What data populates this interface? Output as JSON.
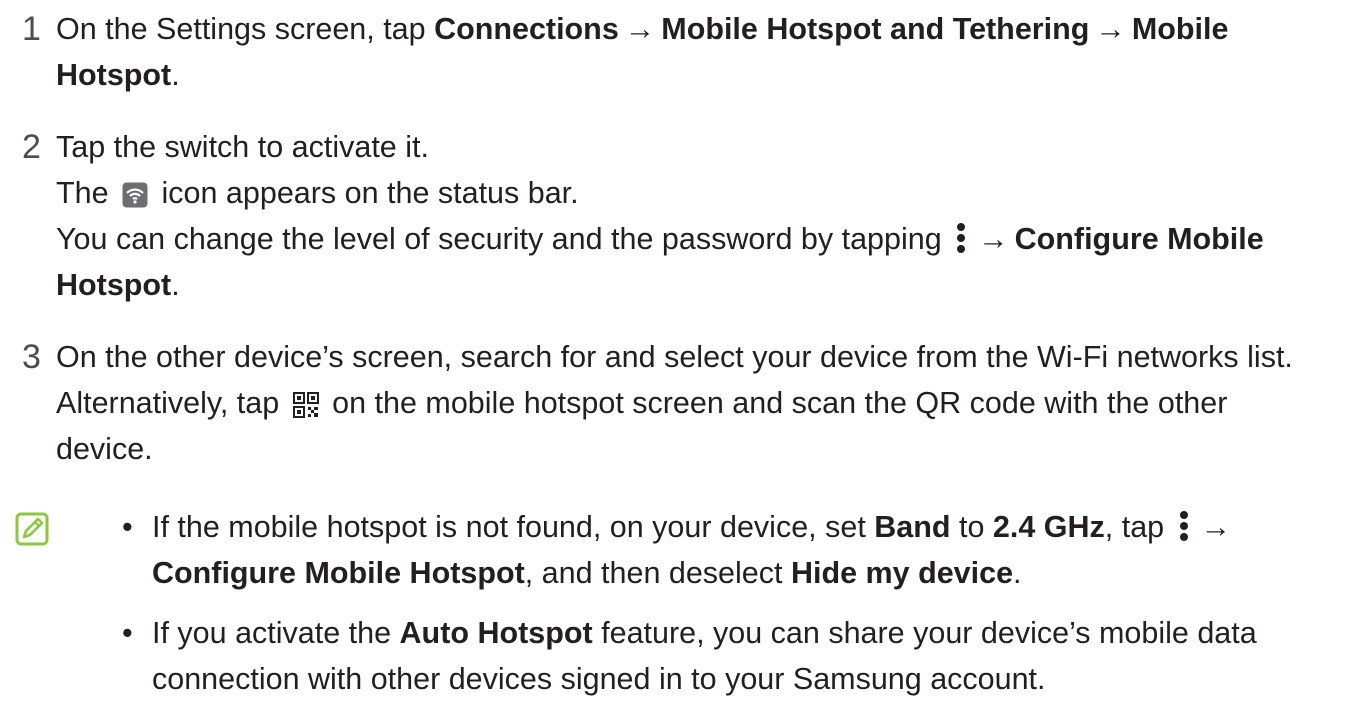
{
  "steps": [
    {
      "number": "1",
      "lines": [
        [
          "On the Settings screen, tap ",
          "Connections",
          "→",
          "Mobile Hotspot and Tethering",
          "→",
          "Mobile"
        ],
        [
          "Hotspot",
          "."
        ]
      ]
    },
    {
      "number": "2",
      "line1": "Tap the switch to activate it.",
      "line2_a": "The ",
      "line2_b": " icon appears on the status bar.",
      "line3_a": "You can change the level of security and the password by tapping ",
      "line3_arrow": "→",
      "line3_bold": "Configure Mobile",
      "line4_bold": "Hotspot",
      "line4_end": "."
    },
    {
      "number": "3",
      "line1": "On the other device’s screen, search for and select your device from the Wi-Fi networks list.",
      "line2_a": "Alternatively, tap ",
      "line2_b": " on the mobile hotspot screen and scan the QR code with the other",
      "line3": "device."
    }
  ],
  "note": {
    "icon": "note-icon",
    "bullet_glyph": "•",
    "b1_l1_a": "If the mobile hotspot is not found, on your device, set ",
    "b1_l1_band": "Band",
    "b1_l1_to": " to ",
    "b1_l1_ghz": "2.4 GHz",
    "b1_l1_tap": ", tap ",
    "b1_l1_arrow": "→",
    "b1_l2_bold": "Configure Mobile Hotspot",
    "b1_l2_mid": ", and then deselect ",
    "b1_l2_bold2": "Hide my device",
    "b1_l2_end": ".",
    "b2_l1_a": "If you activate the ",
    "b2_l1_bold": "Auto Hotspot",
    "b2_l1_b": " feature, you can share your device’s mobile data",
    "b2_l2": "connection with other devices signed in to your Samsung account."
  },
  "colors": {
    "text": "#231f20",
    "number": "#4d4d4f",
    "note_icon": "#8dc63f"
  }
}
